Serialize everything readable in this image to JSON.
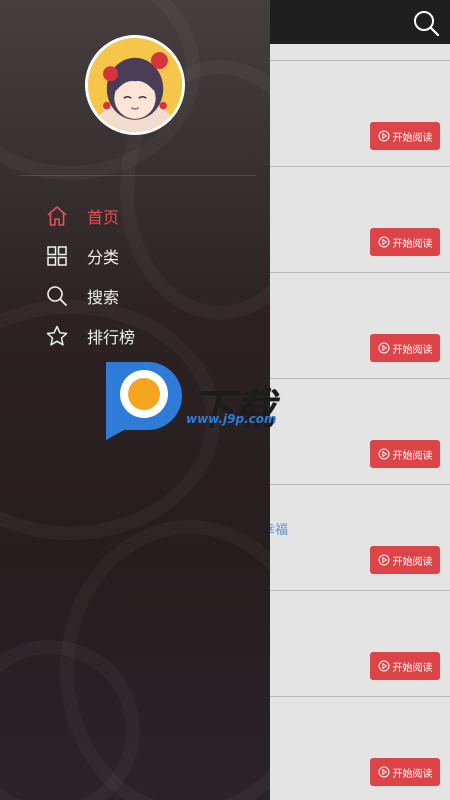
{
  "main": {
    "read_button_label": "开始阅读",
    "items": [
      {
        "snippet": ""
      },
      {
        "snippet": ""
      },
      {
        "snippet": ""
      },
      {
        "snippet": ""
      },
      {
        "snippet": "幸福"
      },
      {
        "snippet": ")"
      },
      {
        "snippet": ""
      }
    ]
  },
  "drawer": {
    "menu": [
      {
        "label": "首页",
        "icon": "home-icon",
        "active": true
      },
      {
        "label": "分类",
        "icon": "category-grid-icon",
        "active": false
      },
      {
        "label": "搜索",
        "icon": "search-icon",
        "active": false
      },
      {
        "label": "排行榜",
        "icon": "star-icon",
        "active": false
      }
    ]
  },
  "watermark": {
    "text": "下载",
    "url": "www.j9p.com"
  },
  "colors": {
    "accent": "#dd4448",
    "active_menu": "#e25256",
    "drawer_bg": "#2c2223",
    "topbar": "#1f1f1f",
    "link": "#5a8fc8"
  }
}
